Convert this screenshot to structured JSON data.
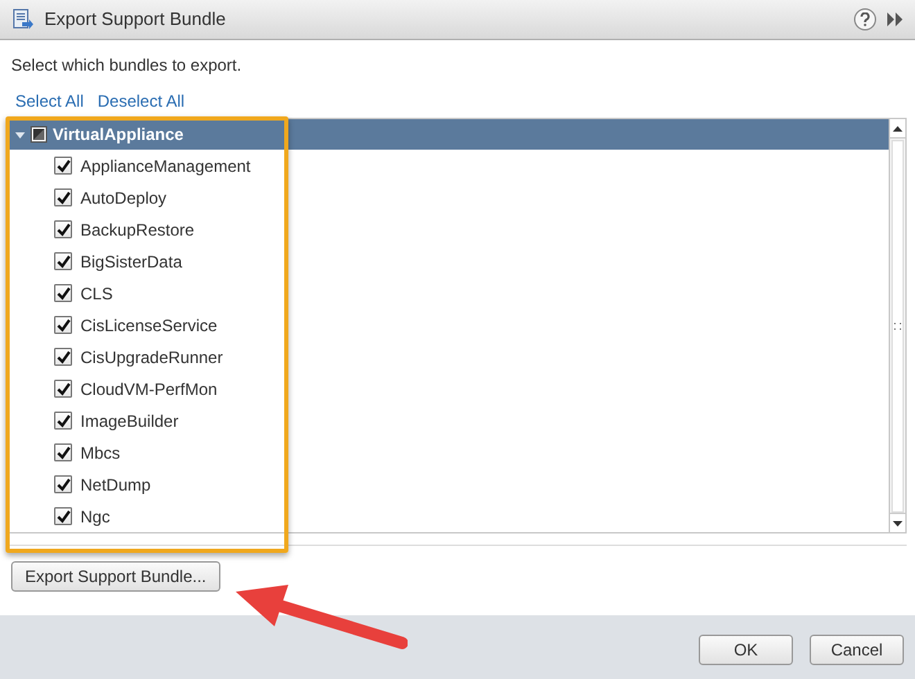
{
  "window": {
    "title": "Export Support Bundle"
  },
  "instruction": "Select which bundles to export.",
  "links": [
    "Select All",
    "Deselect All"
  ],
  "tree": {
    "label": "VirtualAppliance",
    "expanded": true,
    "selected": true,
    "indeterminate": true,
    "children": [
      {
        "label": "ApplianceManagement",
        "checked": true
      },
      {
        "label": "AutoDeploy",
        "checked": true
      },
      {
        "label": "BackupRestore",
        "checked": true
      },
      {
        "label": "BigSisterData",
        "checked": true
      },
      {
        "label": "CLS",
        "checked": true
      },
      {
        "label": "CisLicenseService",
        "checked": true
      },
      {
        "label": "CisUpgradeRunner",
        "checked": true
      },
      {
        "label": "CloudVM-PerfMon",
        "checked": true
      },
      {
        "label": "ImageBuilder",
        "checked": true
      },
      {
        "label": "Mbcs",
        "checked": true
      },
      {
        "label": "NetDump",
        "checked": true
      },
      {
        "label": "Ngc",
        "checked": true
      }
    ]
  },
  "export_button": "Export Support Bundle...",
  "buttons": [
    "OK",
    "Cancel"
  ]
}
